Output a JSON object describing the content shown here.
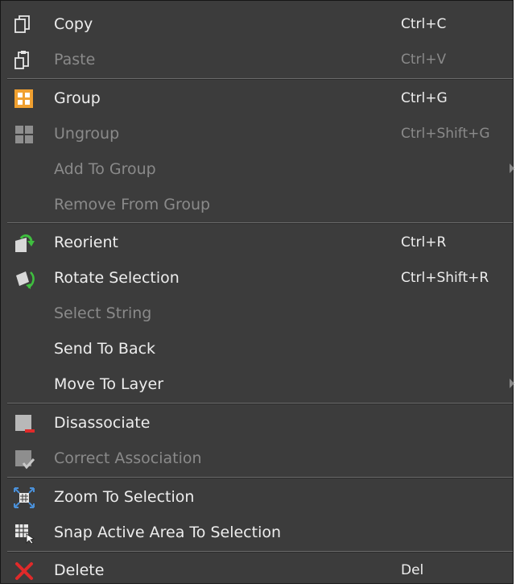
{
  "menu": {
    "items": [
      {
        "label": "Copy",
        "shortcut": "Ctrl+C",
        "icon": "copy-icon",
        "enabled": true
      },
      {
        "label": "Paste",
        "shortcut": "Ctrl+V",
        "icon": "paste-icon",
        "enabled": false
      },
      {
        "label": "Group",
        "shortcut": "Ctrl+G",
        "icon": "group-icon",
        "enabled": true
      },
      {
        "label": "Ungroup",
        "shortcut": "Ctrl+Shift+G",
        "icon": "ungroup-icon",
        "enabled": false
      },
      {
        "label": "Add To Group",
        "shortcut": "",
        "icon": "",
        "enabled": false,
        "submenu": true
      },
      {
        "label": "Remove From Group",
        "shortcut": "",
        "icon": "",
        "enabled": false
      },
      {
        "label": "Reorient",
        "shortcut": "Ctrl+R",
        "icon": "reorient-icon",
        "enabled": true
      },
      {
        "label": "Rotate Selection",
        "shortcut": "Ctrl+Shift+R",
        "icon": "rotate-selection-icon",
        "enabled": true
      },
      {
        "label": "Select String",
        "shortcut": "",
        "icon": "",
        "enabled": false
      },
      {
        "label": "Send To Back",
        "shortcut": "",
        "icon": "",
        "enabled": true
      },
      {
        "label": "Move To Layer",
        "shortcut": "",
        "icon": "",
        "enabled": true,
        "submenu": true
      },
      {
        "label": "Disassociate",
        "shortcut": "",
        "icon": "disassociate-icon",
        "enabled": true
      },
      {
        "label": "Correct Association",
        "shortcut": "",
        "icon": "correct-association-icon",
        "enabled": false
      },
      {
        "label": "Zoom To Selection",
        "shortcut": "",
        "icon": "zoom-to-selection-icon",
        "enabled": true
      },
      {
        "label": "Snap Active Area To Selection",
        "shortcut": "",
        "icon": "snap-active-area-icon",
        "enabled": true
      },
      {
        "label": "Delete",
        "shortcut": "Del",
        "icon": "delete-icon",
        "enabled": true
      }
    ]
  },
  "colors": {
    "background": "#3c3c3c",
    "text": "#ededed",
    "disabled_text": "#8a8a8a",
    "accent_orange": "#f0a030",
    "accent_green": "#3fbf3f",
    "delete_red": "#e02a2a",
    "zoom_blue": "#4a90d9"
  }
}
